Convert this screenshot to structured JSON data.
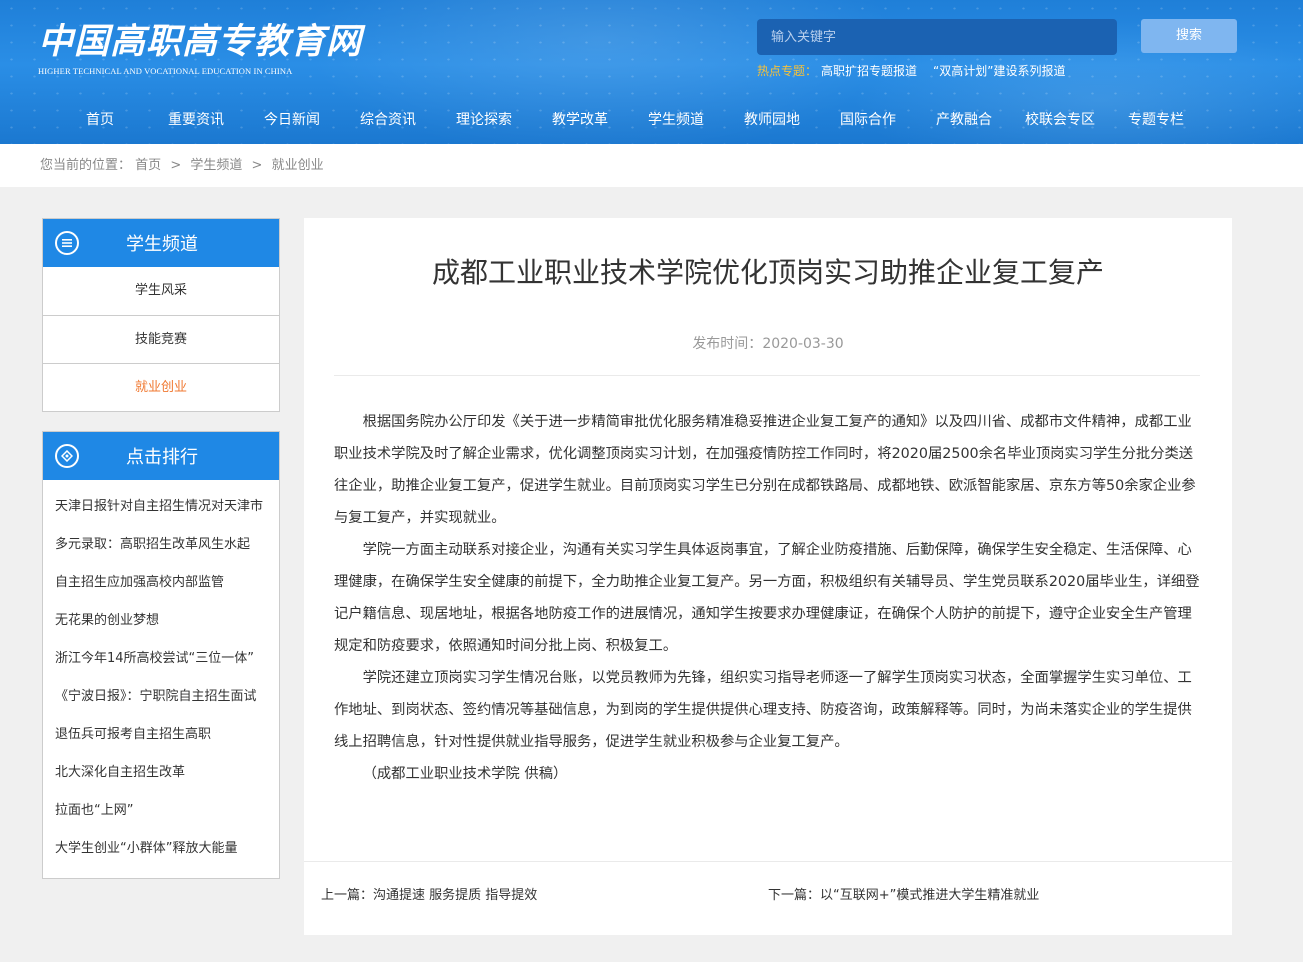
{
  "header": {
    "logo_cn": "中国高职高专教育网",
    "logo_en": "HIGHER TECHNICAL AND VOCATIONAL EDUCATION IN CHINA",
    "search_placeholder": "输入关键字",
    "search_button": "搜索",
    "hot_label": "热点专题：",
    "hot_links": [
      "高职扩招专题报道",
      "“双高计划”建设系列报道"
    ]
  },
  "nav": [
    "首页",
    "重要资讯",
    "今日新闻",
    "综合资讯",
    "理论探索",
    "教学改革",
    "学生频道",
    "教师园地",
    "国际合作",
    "产教融合",
    "校联会专区",
    "专题专栏"
  ],
  "breadcrumb": {
    "prefix": "您当前的位置：",
    "items": [
      "首页",
      "学生频道",
      "就业创业"
    ],
    "sep": ">"
  },
  "sidebar": {
    "channel_title": "学生频道",
    "channel_items": [
      "学生风采",
      "技能竞赛",
      "就业创业"
    ],
    "active_item": "就业创业",
    "ranking_title": "点击排行",
    "ranking_items": [
      "天津日报针对自主招生情况对天津市",
      "多元录取：高职招生改革风生水起",
      "自主招生应加强高校内部监管",
      "无花果的创业梦想",
      "浙江今年14所高校尝试“三位一体”",
      "《宁波日报》：宁职院自主招生面试",
      "退伍兵可报考自主招生高职",
      "北大深化自主招生改革",
      "拉面也“上网”",
      "大学生创业“小群体”释放大能量"
    ]
  },
  "article": {
    "title": "成都工业职业技术学院优化顶岗实习助推企业复工复产",
    "date_label": "发布时间：",
    "date": "2020-03-30",
    "paragraphs": [
      "根据国务院办公厅印发《关于进一步精简审批优化服务精准稳妥推进企业复工复产的通知》以及四川省、成都市文件精神，成都工业职业技术学院及时了解企业需求，优化调整顶岗实习计划，在加强疫情防控工作同时，将2020届2500余名毕业顶岗实习学生分批分类送往企业，助推企业复工复产，促进学生就业。目前顶岗实习学生已分别在成都铁路局、成都地铁、欧派智能家居、京东方等50余家企业参与复工复产，并实现就业。",
      "学院一方面主动联系对接企业，沟通有关实习学生具体返岗事宜，了解企业防疫措施、后勤保障，确保学生安全稳定、生活保障、心理健康，在确保学生安全健康的前提下，全力助推企业复工复产。另一方面，积极组织有关辅导员、学生党员联系2020届毕业生，详细登记户籍信息、现居地址，根据各地防疫工作的进展情况，通知学生按要求办理健康证，在确保个人防护的前提下，遵守企业安全生产管理规定和防疫要求，依照通知时间分批上岗、积极复工。",
      "学院还建立顶岗实习学生情况台账，以党员教师为先锋，组织实习指导老师逐一了解学生顶岗实习状态，全面掌握学生实习单位、工作地址、到岗状态、签约情况等基础信息，为到岗的学生提供提供心理支持、防疫咨询，政策解释等。同时，为尚未落实企业的学生提供线上招聘信息，针对性提供就业指导服务，促进学生就业积极参与企业复工复产。",
      "（成都工业职业技术学院 供稿）"
    ],
    "prev_label": "上一篇：",
    "prev_title": "沟通提速 服务提质 指导提效",
    "next_label": "下一篇：",
    "next_title": "以“互联网+”模式推进大学生精准就业"
  }
}
